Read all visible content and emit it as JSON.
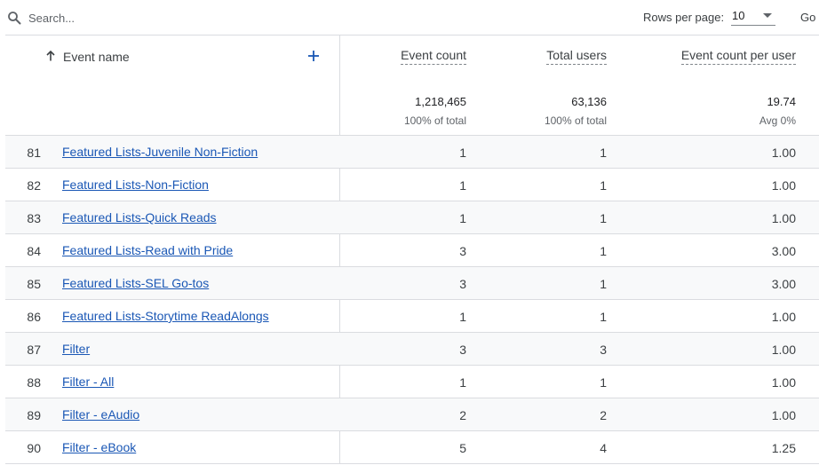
{
  "toolbar": {
    "search_placeholder": "Search...",
    "search_icon": "search-icon",
    "rows_per_page_label": "Rows per page:",
    "rows_per_page_value": "10",
    "goto_label": "Go to:"
  },
  "table": {
    "columns": {
      "event_name": "Event name",
      "event_count": "Event count",
      "total_users": "Total users",
      "event_count_per_user": "Event count per user"
    },
    "totals": {
      "event_count": "1,218,465",
      "event_count_sub": "100% of total",
      "total_users": "63,136",
      "total_users_sub": "100% of total",
      "per_user": "19.74",
      "per_user_sub": "Avg 0%"
    },
    "rows": [
      {
        "num": "81",
        "name": "Featured Lists-Juvenile Non-Fiction",
        "count": "1",
        "users": "1",
        "per_user": "1.00"
      },
      {
        "num": "82",
        "name": "Featured Lists-Non-Fiction",
        "count": "1",
        "users": "1",
        "per_user": "1.00"
      },
      {
        "num": "83",
        "name": "Featured Lists-Quick Reads",
        "count": "1",
        "users": "1",
        "per_user": "1.00"
      },
      {
        "num": "84",
        "name": "Featured Lists-Read with Pride",
        "count": "3",
        "users": "1",
        "per_user": "3.00"
      },
      {
        "num": "85",
        "name": "Featured Lists-SEL Go-tos",
        "count": "3",
        "users": "1",
        "per_user": "3.00"
      },
      {
        "num": "86",
        "name": "Featured Lists-Storytime ReadAlongs",
        "count": "1",
        "users": "1",
        "per_user": "1.00"
      },
      {
        "num": "87",
        "name": "Filter",
        "count": "3",
        "users": "3",
        "per_user": "1.00"
      },
      {
        "num": "88",
        "name": "Filter - All",
        "count": "1",
        "users": "1",
        "per_user": "1.00"
      },
      {
        "num": "89",
        "name": "Filter - eAudio",
        "count": "2",
        "users": "2",
        "per_user": "1.00"
      },
      {
        "num": "90",
        "name": "Filter - eBook",
        "count": "5",
        "users": "4",
        "per_user": "1.25"
      }
    ]
  }
}
